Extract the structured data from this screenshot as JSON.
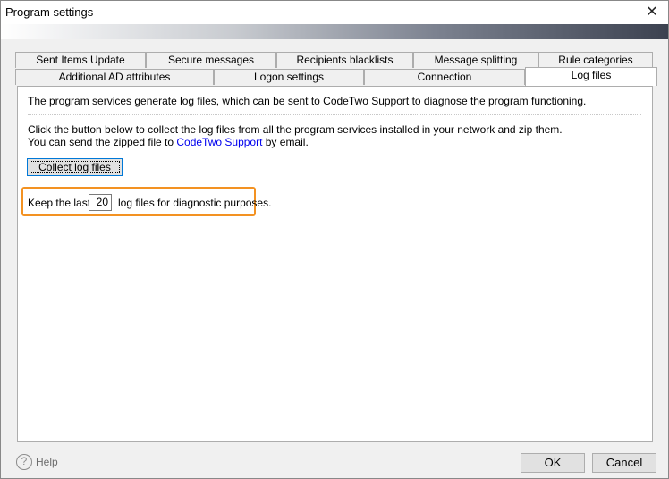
{
  "window": {
    "title": "Program settings",
    "close_glyph": "✕"
  },
  "tabs_row1": [
    {
      "label": "Sent Items Update"
    },
    {
      "label": "Secure messages"
    },
    {
      "label": "Recipients blacklists"
    },
    {
      "label": "Message splitting"
    },
    {
      "label": "Rule categories"
    }
  ],
  "tabs_row2": [
    {
      "label": "Additional AD attributes"
    },
    {
      "label": "Logon settings"
    },
    {
      "label": "Connection"
    },
    {
      "label": "Log files",
      "active": true
    }
  ],
  "panel": {
    "intro": "The program services generate log files, which can be sent to CodeTwo Support to diagnose the program functioning.",
    "desc_before": "Click the button below to collect the log files from all the program services installed in your network and zip them. You can send the zipped file to ",
    "desc_link": "CodeTwo Support",
    "desc_after": " by email.",
    "collect_button": "Collect log files",
    "keep_label": "Keep the last",
    "keep_value": "20",
    "keep_suffix": "log files for diagnostic purposes.",
    "highlight_color": "#f39222"
  },
  "footer": {
    "help_icon": "?",
    "help_label": "Help",
    "ok_label": "OK",
    "cancel_label": "Cancel"
  }
}
